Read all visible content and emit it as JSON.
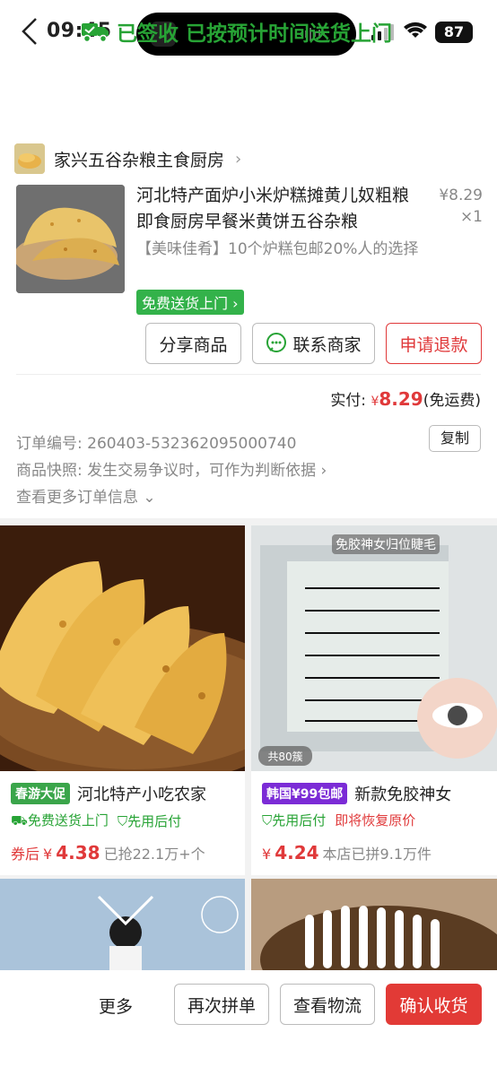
{
  "status_bar": {
    "time": "09:45",
    "battery": "87"
  },
  "header": {
    "status_title": "已签收 已按预计时间送货上门"
  },
  "shop": {
    "name": "家兴五谷杂粮主食厨房"
  },
  "product": {
    "title": "河北特产面炉小米炉糕摊黄儿奴粗粮即食厨房早餐米黄饼五谷杂粮",
    "price": "¥8.29",
    "qty": "×1",
    "desc": "【美味佳肴】10个炉糕包邮20%人的选择",
    "free_delivery_tag": "免费送货上门"
  },
  "actions": {
    "share": "分享商品",
    "contact": "联系商家",
    "refund": "申请退款"
  },
  "payment": {
    "label": "实付:",
    "yen": "¥",
    "amount": "8.29",
    "note": "(免运费)"
  },
  "order_info": {
    "order_no_label": "订单编号:",
    "order_no": "260403-532362095000740",
    "copy": "复制",
    "snapshot_label": "商品快照:",
    "snapshot_text": "发生交易争议时，可作为判断依据",
    "more_info": "查看更多订单信息"
  },
  "recommendations": [
    {
      "badge": "春游大促",
      "title": "河北特产小吃农家",
      "tag1": "免费送货上门",
      "tag2": "先用后付",
      "price_prefix": "券后",
      "yen": "¥",
      "price": "4.38",
      "sales": "已抢22.1万+个"
    },
    {
      "badge": "韩国¥99包邮",
      "title": "新款免胶神女",
      "image_caption": "免胶神女归位睫毛",
      "image_count": "共80簇",
      "tag1": "先用后付",
      "tag2": "即将恢复原价",
      "yen": "¥",
      "price": "4.24",
      "sales": "本店已拼9.1万件"
    }
  ],
  "bottom_bar": {
    "more": "更多",
    "reorder": "再次拼单",
    "logistics": "查看物流",
    "confirm": "确认收货"
  },
  "colors": {
    "green": "#27a335",
    "red": "#e0393a",
    "purple": "#7b2bd6"
  }
}
